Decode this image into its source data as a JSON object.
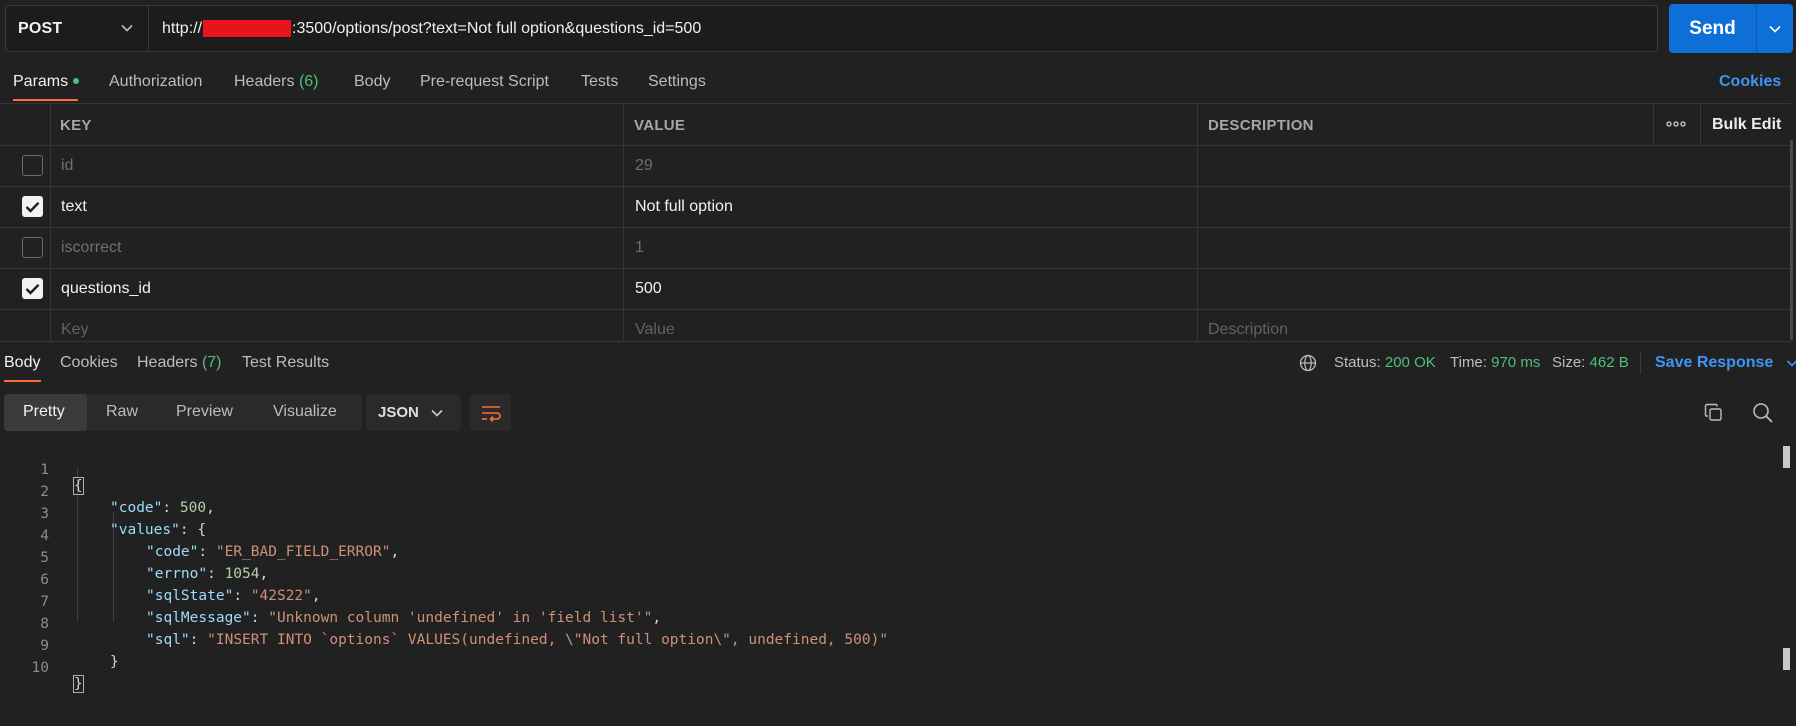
{
  "request": {
    "method": "POST",
    "url_prefix": "http://",
    "url_suffix": ":3500/options/post?text=Not full option&questions_id=500",
    "send_label": "Send"
  },
  "request_tabs": {
    "params": "Params",
    "authorization": "Authorization",
    "headers": "Headers",
    "headers_count": "(6)",
    "body": "Body",
    "prerequest": "Pre-request Script",
    "tests": "Tests",
    "settings": "Settings",
    "cookies": "Cookies"
  },
  "params_table": {
    "headers": {
      "key": "KEY",
      "value": "VALUE",
      "description": "DESCRIPTION",
      "bulk_edit": "Bulk Edit"
    },
    "rows": [
      {
        "checked": false,
        "key": "id",
        "value": "29",
        "description": ""
      },
      {
        "checked": true,
        "key": "text",
        "value": "Not full option",
        "description": ""
      },
      {
        "checked": false,
        "key": "iscorrect",
        "value": "1",
        "description": ""
      },
      {
        "checked": true,
        "key": "questions_id",
        "value": "500",
        "description": ""
      }
    ],
    "placeholders": {
      "key": "Key",
      "value": "Value",
      "description": "Description"
    }
  },
  "response_tabs": {
    "body": "Body",
    "cookies": "Cookies",
    "headers": "Headers",
    "headers_count": "(7)",
    "test_results": "Test Results"
  },
  "response_status": {
    "status_label": "Status:",
    "status_value": "200 OK",
    "time_label": "Time:",
    "time_value": "970 ms",
    "size_label": "Size:",
    "size_value": "462 B",
    "save_response": "Save Response"
  },
  "response_toolbar": {
    "views": [
      "Pretty",
      "Raw",
      "Preview",
      "Visualize"
    ],
    "format": "JSON"
  },
  "response_body": {
    "line_numbers": [
      "1",
      "2",
      "3",
      "4",
      "5",
      "6",
      "7",
      "8",
      "9",
      "10"
    ],
    "open_brace": "{",
    "close_brace": "}",
    "code_key": "\"code\"",
    "code_value": "500",
    "values_key": "\"values\"",
    "values_open": "{",
    "values_close": "}",
    "inner": [
      {
        "key": "\"code\"",
        "value": "\"ER_BAD_FIELD_ERROR\"",
        "type": "string"
      },
      {
        "key": "\"errno\"",
        "value": "1054",
        "type": "number"
      },
      {
        "key": "\"sqlState\"",
        "value": "\"42S22\"",
        "type": "string"
      },
      {
        "key": "\"sqlMessage\"",
        "value": "\"Unknown column 'undefined' in 'field list'\"",
        "type": "string"
      },
      {
        "key": "\"sql\"",
        "value": "\"INSERT INTO `options` VALUES(undefined, \\\"Not full option\\\", undefined, 500)\"",
        "type": "string"
      }
    ]
  },
  "colors": {
    "background": "#212121",
    "accent_orange": "#ff6c37",
    "send_blue": "#0f6fd8",
    "link_blue": "#3d96f5",
    "status_green": "#4fbf7a",
    "redaction_red": "#e8131c"
  },
  "icons": [
    "chevron-down-icon",
    "more-horizontal-icon",
    "check-icon",
    "globe-icon",
    "wrap-lines-icon",
    "copy-icon",
    "search-icon"
  ]
}
